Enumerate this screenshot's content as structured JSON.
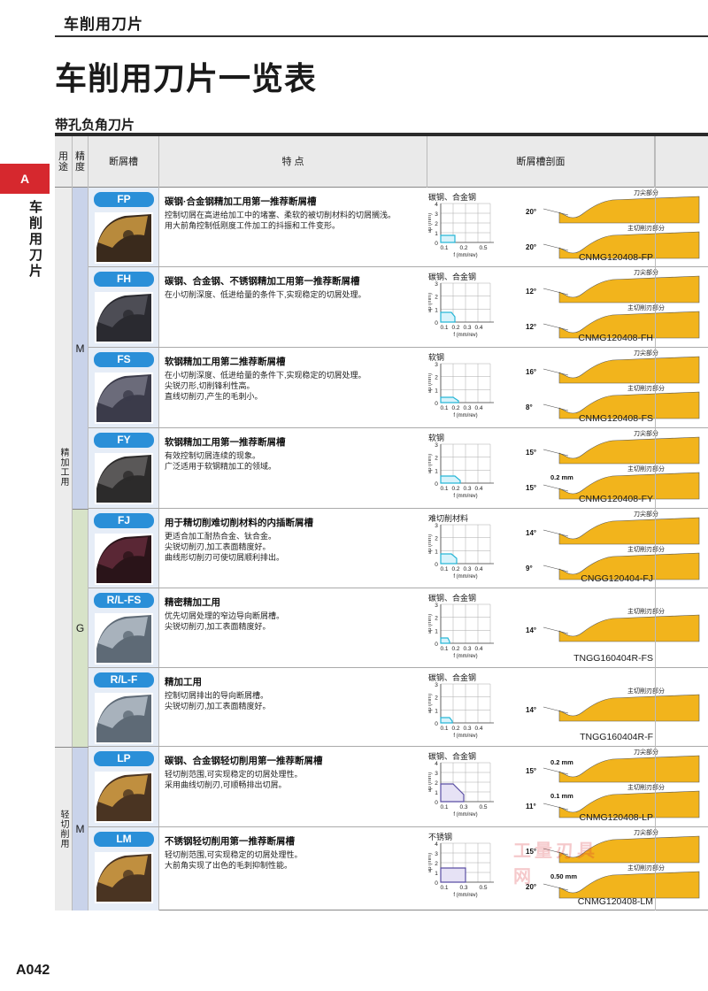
{
  "header": {
    "title": "车削用刀片"
  },
  "page_title": "车削用刀片一览表",
  "section_title": "带孔负角刀片",
  "side_tab": {
    "letter": "A",
    "label": "车削用刀片"
  },
  "table_headers": {
    "use": "用途",
    "precision": "精度",
    "breaker": "断屑槽",
    "features": "特 点",
    "profile": "断屑槽剖面"
  },
  "groups": {
    "finish": "精加工用",
    "light": "轻切削用"
  },
  "precision_labels": {
    "m1": "M",
    "g": "G",
    "m2": "M"
  },
  "chart_axis": {
    "ylabel": "ap (mm)",
    "xlabel": "f (mm/rev)"
  },
  "rows": [
    {
      "code": "FP",
      "title": "碳钢·合金钢精加工用第一推荐断屑槽",
      "lines": [
        "控制切屑在高进给加工中的堵塞、柔软的被切削材料的切屑搁浅。",
        "用大前角控制低刚度工件加工的抖振和工件变形。"
      ],
      "material": "碳钢、合金钢",
      "yticks": [
        "4",
        "3",
        "2",
        "1",
        "0"
      ],
      "xticks": [
        "0.1",
        "0.2",
        "0.5"
      ],
      "angles": [
        "20°",
        "20°"
      ],
      "labels": [
        "刀尖部分",
        "主切削刃部分"
      ],
      "dim": "",
      "model": "CNMG120408-FP"
    },
    {
      "code": "FH",
      "title": "碳钢、合金钢、不锈钢精加工用第一推荐断屑槽",
      "lines": [
        "在小切削深度、低进给量的条件下,实现稳定的切屑处理。"
      ],
      "material": "碳钢、合金钢",
      "yticks": [
        "3",
        "2",
        "1",
        "0"
      ],
      "xticks": [
        "0.1",
        "0.2",
        "0.3",
        "0.4"
      ],
      "angles": [
        "12°",
        "12°"
      ],
      "labels": [
        "刀尖部分",
        "主切削刃部分"
      ],
      "dim": "",
      "model": "CNMG120408-FH"
    },
    {
      "code": "FS",
      "title": "软钢精加工用第二推荐断屑槽",
      "lines": [
        "在小切削深度、低进给量的条件下,实现稳定的切屑处理。",
        "尖锐刃形,切削锋利性高。",
        "直线切削刃,产生的毛刺小。"
      ],
      "material": "软钢",
      "yticks": [
        "3",
        "2",
        "1",
        "0"
      ],
      "xticks": [
        "0.1",
        "0.2",
        "0.3",
        "0.4"
      ],
      "angles": [
        "16°",
        "8°"
      ],
      "labels": [
        "刀尖部分",
        "主切削刃部分"
      ],
      "dim": "",
      "model": "CNMG120408-FS"
    },
    {
      "code": "FY",
      "title": "软钢精加工用第一推荐断屑槽",
      "lines": [
        "有效控制切屑连续的现象。",
        "广泛适用于软钢精加工的领域。"
      ],
      "material": "软钢",
      "yticks": [
        "3",
        "2",
        "1",
        "0"
      ],
      "xticks": [
        "0.1",
        "0.2",
        "0.3",
        "0.4"
      ],
      "angles": [
        "15°",
        "15°"
      ],
      "labels": [
        "刀尖部分",
        "主切削刃部分"
      ],
      "dim": "0.2 mm",
      "model": "CNMG120408-FY"
    },
    {
      "code": "FJ",
      "title": "用于精切削难切削材料的内插断屑槽",
      "lines": [
        "更适合加工耐热合金、钛合金。",
        "尖锐切削刃,加工表面精度好。",
        "曲线形切削刃可使切屑顺利排出。"
      ],
      "material": "难切削材料",
      "yticks": [
        "3",
        "2",
        "1",
        "0"
      ],
      "xticks": [
        "0.1",
        "0.2",
        "0.3",
        "0.4"
      ],
      "angles": [
        "14°",
        "9°"
      ],
      "labels": [
        "刀尖部分",
        "主切削刃部分"
      ],
      "dim": "",
      "model": "CNGG120404-FJ"
    },
    {
      "code": "R/L-FS",
      "title": "精密精加工用",
      "lines": [
        "优先切屑处理的窄边导向断屑槽。",
        "尖锐切削刃,加工表面精度好。"
      ],
      "material": "碳钢、合金钢",
      "yticks": [
        "3",
        "2",
        "1",
        "0"
      ],
      "xticks": [
        "0.1",
        "0.2",
        "0.3",
        "0.4"
      ],
      "angles": [
        "14°"
      ],
      "labels": [
        "主切削刃部分"
      ],
      "dim": "",
      "model": "TNGG160404R-FS"
    },
    {
      "code": "R/L-F",
      "title": "精加工用",
      "lines": [
        "控制切屑排出的导向断屑槽。",
        "尖锐切削刃,加工表面精度好。"
      ],
      "material": "碳钢、合金钢",
      "yticks": [
        "3",
        "2",
        "1",
        "0"
      ],
      "xticks": [
        "0.1",
        "0.2",
        "0.3",
        "0.4"
      ],
      "angles": [
        "14°"
      ],
      "labels": [
        "主切削刃部分"
      ],
      "dim": "",
      "model": "TNGG160404R-F"
    },
    {
      "code": "LP",
      "title": "碳钢、合金钢轻切削用第一推荐断屑槽",
      "lines": [
        "轻切削范围,可实现稳定的切屑处理性。",
        "采用曲线切削刃,可顺畅排出切屑。"
      ],
      "material": "碳钢、合金钢",
      "yticks": [
        "4",
        "3",
        "2",
        "1",
        "0"
      ],
      "xticks": [
        "0.1",
        "0.3",
        "0.5"
      ],
      "angles": [
        "15°",
        "11°"
      ],
      "labels": [
        "刀尖部分",
        "主切削刃部分"
      ],
      "dim": "0.1 mm",
      "dim2": "0.2 mm",
      "model": "CNMG120408-LP"
    },
    {
      "code": "LM",
      "title": "不锈钢轻切削用第一推荐断屑槽",
      "lines": [
        "轻切削范围,可实现稳定的切屑处理性。",
        "大前角实现了出色的毛刺抑制性能。"
      ],
      "material": "不锈钢",
      "yticks": [
        "4",
        "3",
        "2",
        "1",
        "0"
      ],
      "xticks": [
        "0.1",
        "0.3",
        "0.5"
      ],
      "angles": [
        "15°",
        "20°"
      ],
      "labels": [
        "刀尖部分",
        "主切削刃部分"
      ],
      "dim": "0.50 mm",
      "model": "CNMG120408-LM"
    }
  ],
  "watermark": "工量刃具网",
  "page_number": "A042",
  "colors": {
    "accent_red": "#d6282e",
    "badge_blue": "#2a8fd8",
    "profile_gold": "#f2b41c",
    "chart_cyan": "#27b6d6",
    "chart_purple": "#5b4fa3"
  }
}
